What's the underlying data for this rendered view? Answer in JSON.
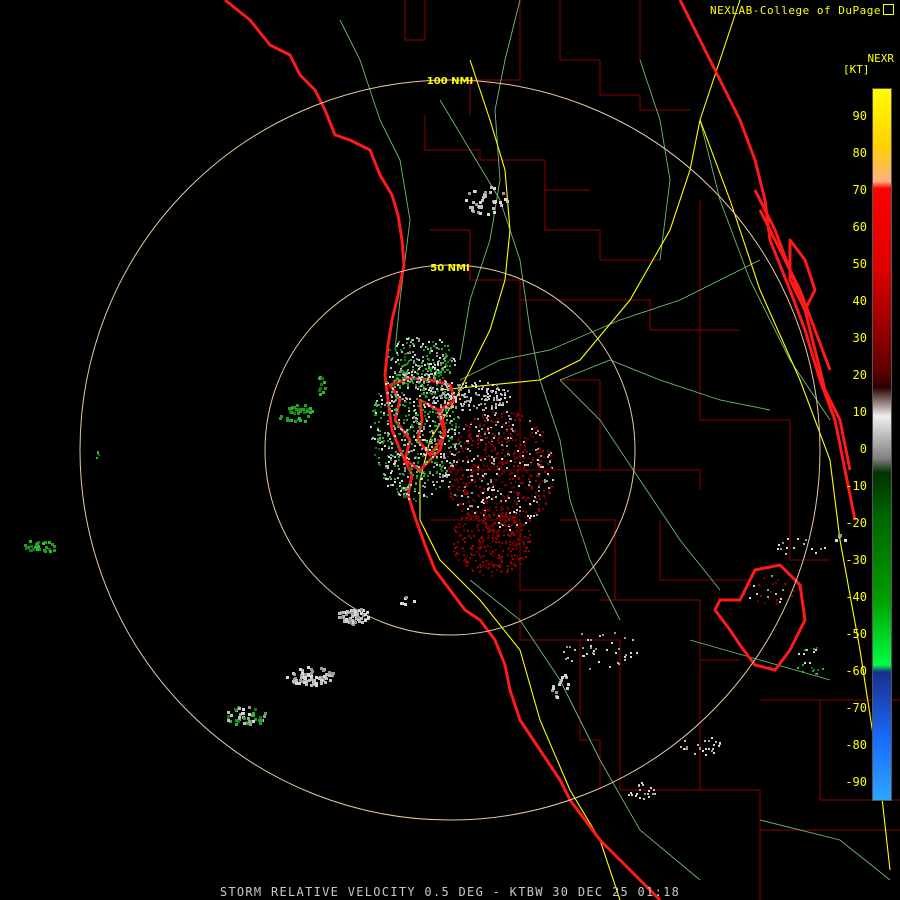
{
  "credit": "NEXLAB-College of DuPage",
  "legend": {
    "product": "NEXR",
    "unit": "[KT]",
    "ticks": [
      "90",
      "80",
      "70",
      "60",
      "50",
      "40",
      "30",
      "20",
      "10",
      "0",
      "-10",
      "-20",
      "-30",
      "-40",
      "-50",
      "-60",
      "-70",
      "-80",
      "-90"
    ]
  },
  "range_rings": [
    {
      "label": "100 NMI"
    },
    {
      "label": "50 NMI"
    }
  ],
  "footer": "STORM RELATIVE VELOCITY 0.5 DEG - KTBW 30 DEC 25 01:18",
  "colors": {
    "background": "#000000",
    "coastline": "#ff1a1a",
    "roads": "#ffff00",
    "highways": "#7fdf7f",
    "county_lines": "#8b0000",
    "range_ring": "#e8c9a0",
    "inbound_green": "#1f9d1f",
    "outbound_red": "#8b0000",
    "near_zero_gray": "#bfbfbf"
  }
}
